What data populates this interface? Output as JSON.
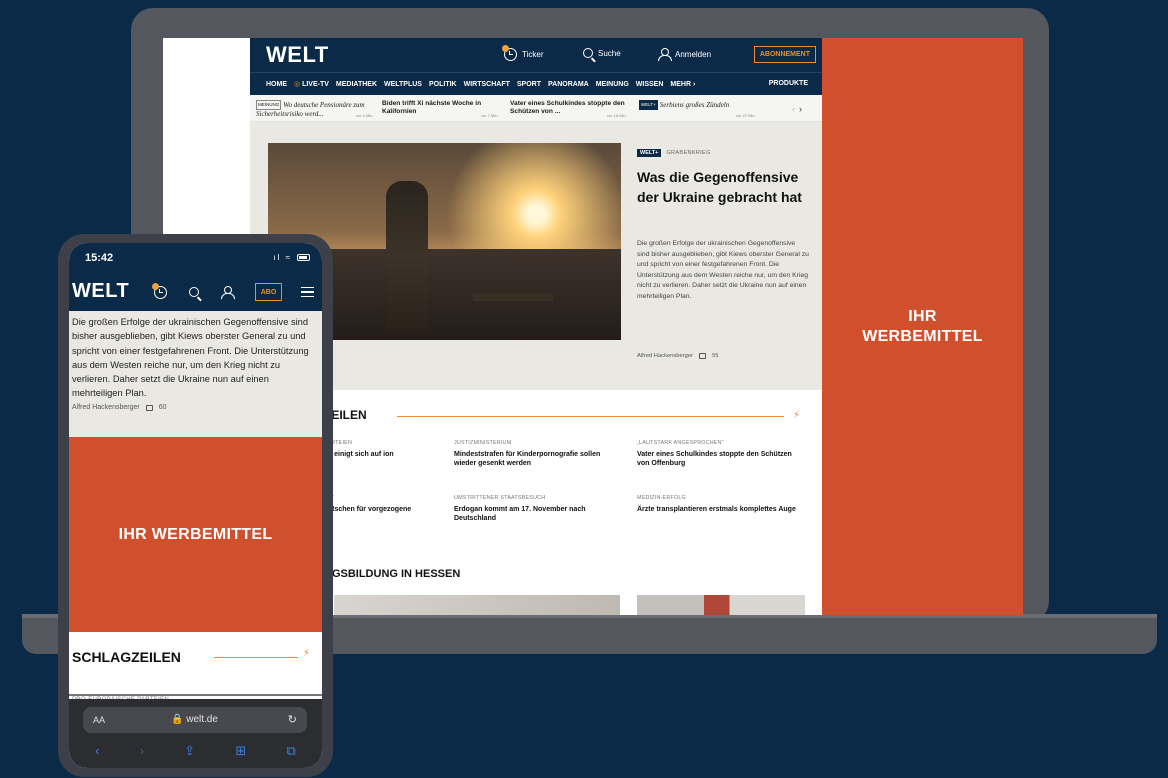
{
  "laptop": {
    "header": {
      "logo": "WELT",
      "ticker_label": "Ticker",
      "search_label": "Suche",
      "login_label": "Anmelden",
      "subscribe_label": "ABONNEMENT"
    },
    "nav": {
      "items": [
        "HOME",
        "LIVE-TV",
        "MEDIATHEK",
        "WELTPLUS",
        "POLITIK",
        "WIRTSCHAFT",
        "SPORT",
        "PANORAMA",
        "MEINUNG",
        "WISSEN",
        "MEHR"
      ],
      "products": "PRODUKTE"
    },
    "ticker": [
      {
        "tag": "MEINUNG",
        "text": "Wo deutsche Pensionäre zum Sicherheitsrisiko werd...",
        "time": "vor 4 Min."
      },
      {
        "tag": "",
        "text": "Biden trifft Xi nächste Woche in Kalifornien",
        "time": "vor 7 Min."
      },
      {
        "tag": "",
        "text": "Vater eines Schulkindes stoppte den Schützen von ...",
        "time": "vor 16 Min."
      },
      {
        "tag": "WELT+",
        "text": "Serbiens großes Zündeln",
        "time": "vor 27 Min."
      }
    ],
    "hero": {
      "badge": "WELT+",
      "kicker": "GRABENKRIEG",
      "title": "Was die Gegenoffensive der Ukraine gebracht hat",
      "text": "Die großen Erfolge der ukrainischen Gegenoffensive sind bisher ausgeblieben, gibt Kiews oberster General zu und spricht von einer festgefahrenen Front. Die Unterstützung aus dem Westen reiche nur, um den Krieg nicht zu verlieren. Daher setzt die Ukraine nun auf einen mehrteiligen Plan.",
      "author": "Alfred Hackensberger",
      "comments": "55"
    },
    "schlagzeilen": {
      "title": "ZEILEN",
      "items": [
        {
          "kicker": "PARTEIEN",
          "title": "en einigt sich auf ion"
        },
        {
          "kicker": "JUSTIZMINISTERIUM",
          "title": "Mindeststrafen für Kinderpornografie sollen wieder gesenkt werden"
        },
        {
          "kicker": "„LAUTSTARK ANGESPROCHEN“",
          "title": "Vater eines Schulkindes stoppte den Schützen von Offenburg"
        },
        {
          "kicker": "ND“",
          "title": "eutschen für vorgezogene"
        },
        {
          "kicker": "UMSTRITTENER STAATSBESUCH",
          "title": "Erdogan kommt am 17. November nach Deutschland"
        },
        {
          "kicker": "MEDIZIN-ERFOLG",
          "title": "Ärzte transplantieren erstmals komplettes Auge"
        }
      ]
    },
    "bildung": {
      "title": "NGSBILDUNG IN HESSEN"
    },
    "ad": {
      "line1": "IHR",
      "line2": "WERBEMITTEL"
    }
  },
  "phone": {
    "status": {
      "time": "15:42"
    },
    "header": {
      "logo": "WELT",
      "abo": "ABO"
    },
    "article": {
      "text": "Die großen Erfolge der ukrainischen Gegenoffensive sind bisher ausgeblieben, gibt Kiews oberster General zu und spricht von einer festgefahrenen Front. Die Unterstützung aus dem Westen reiche nur, um den Krieg nicht zu verlieren. Daher setzt die Ukraine nun auf einen mehrteiligen Plan.",
      "author": "Alfred Hackensberger",
      "comments": "60"
    },
    "ad": {
      "text": "IHR WERBEMITTEL"
    },
    "schlagzeilen": {
      "title": "SCHLAGZEILEN",
      "kicker": "PRO-EUROPÄISCHE PARTEIEN"
    },
    "safari": {
      "aa": "AA",
      "domain": "welt.de"
    }
  },
  "colors": {
    "brand_navy": "#0b2a48",
    "accent_orange": "#e8902d",
    "ad_red": "#d0502d"
  }
}
